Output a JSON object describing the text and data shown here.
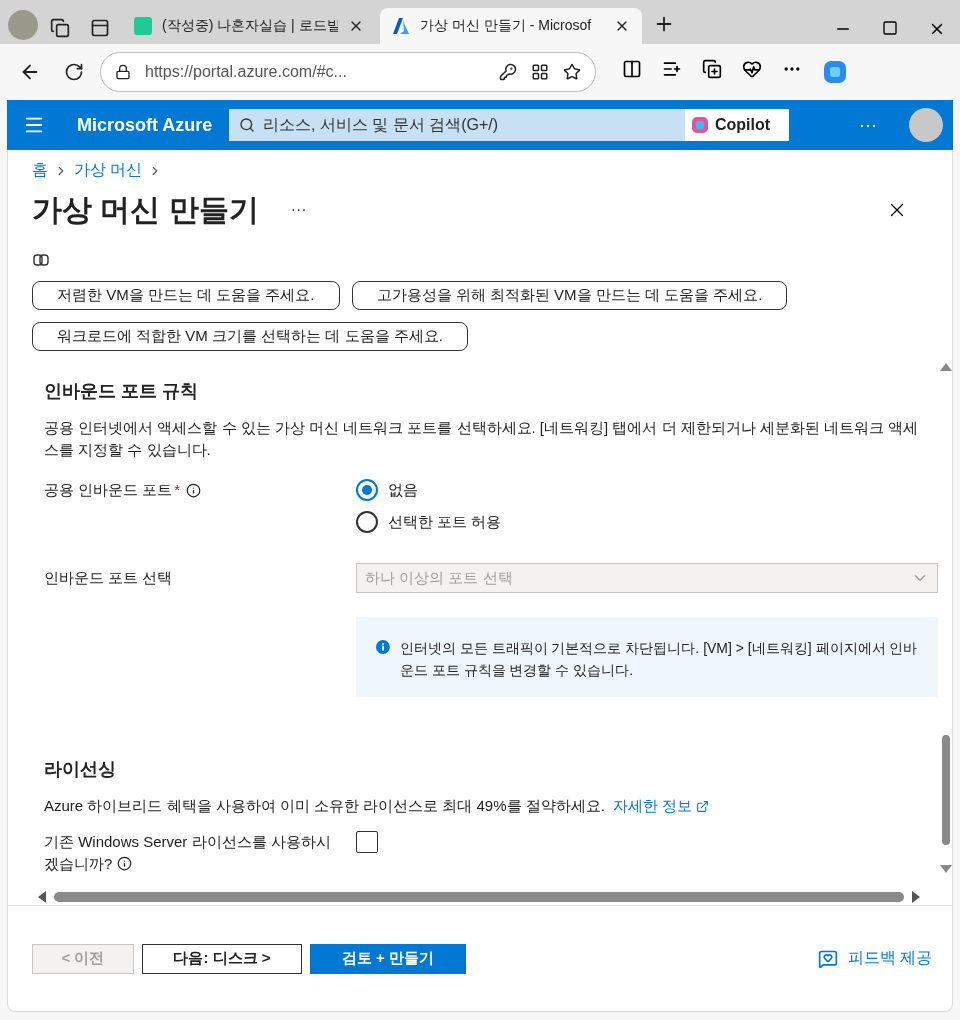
{
  "browser": {
    "tabs": [
      {
        "title": "(작성중) 나혼자실습 | 로드빌",
        "selected": false
      },
      {
        "title": "가상 머신 만들기 - Microsof",
        "selected": true
      }
    ],
    "address": "https://portal.azure.com/#c..."
  },
  "portal": {
    "brand": "Microsoft Azure",
    "search_placeholder": "리소스, 서비스 및 문서 검색(G+/)",
    "copilot": "Copilot",
    "more": "···"
  },
  "breadcrumb": [
    "홈",
    "가상 머신"
  ],
  "page": {
    "title": "가상 머신 만들기",
    "more": "···"
  },
  "suggestions": [
    {
      "label": "저렴한 VM을 만드는 데 도움을 주세요."
    },
    {
      "label": "고가용성을 위해 최적화된 VM을 만드는 데 도움을 주세요."
    },
    {
      "label": "워크로드에 적합한 VM 크기를 선택하는 데 도움을 주세요."
    }
  ],
  "inbound": {
    "heading": "인바운드 포트 규칙",
    "description": "공용 인터넷에서 액세스할 수 있는 가상 머신 네트워크 포트를 선택하세요. [네트워킹] 탭에서 더 제한되거나 세분화된 네트워크 액세스를 지정할 수 있습니다.",
    "port_label": "공용 인바운드 포트",
    "required": "*",
    "radios": [
      {
        "label": "없음",
        "selected": true
      },
      {
        "label": "선택한 포트 허용",
        "selected": false
      }
    ],
    "select_label": "인바운드 포트 선택",
    "select_placeholder": "하나 이상의 포트 선택",
    "select_disabled": true,
    "info": "인터넷의 모든 트래픽이 기본적으로 차단됩니다. [VM] > [네트워킹] 페이지에서 인바운드 포트 규칙을 변경할 수 있습니다."
  },
  "licensing": {
    "heading": "라이선싱",
    "text": "Azure 하이브리드 혜택을 사용하여 이미 소유한 라이선스로 최대 49%를 절약하세요.",
    "link": "자세한 정보",
    "checkbox_label": "기존 Windows Server 라이선스를 사용하시겠습니까?",
    "checked": false
  },
  "footer": {
    "buttons": [
      {
        "label": "< 이전",
        "kind": "disabled"
      },
      {
        "label": "다음: 디스크 >",
        "kind": "outline"
      },
      {
        "label": "검토 + 만들기",
        "kind": "primary"
      }
    ],
    "feedback": "피드백 제공"
  }
}
